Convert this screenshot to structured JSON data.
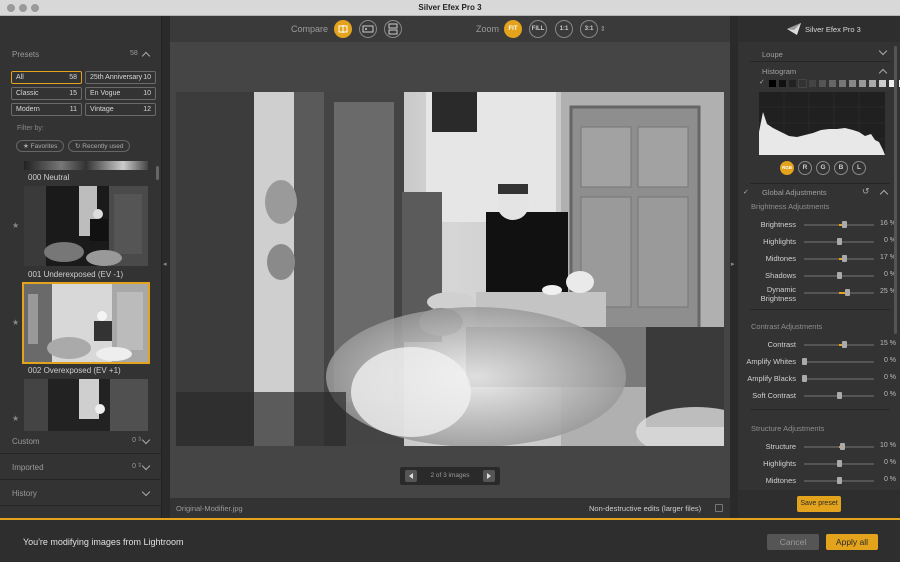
{
  "window": {
    "title": "Silver Efex Pro 3"
  },
  "left_panel": {
    "presets_label": "Presets",
    "presets_count": "58",
    "preset_categories": [
      {
        "name": "All",
        "count": "58"
      },
      {
        "name": "25th Anniversary",
        "count": "10"
      },
      {
        "name": "Classic",
        "count": "15"
      },
      {
        "name": "En Vogue",
        "count": "10"
      },
      {
        "name": "Modern",
        "count": "11"
      },
      {
        "name": "Vintage",
        "count": "12"
      }
    ],
    "filter_label": "Filter by:",
    "filters": [
      "Favorites",
      "Recently used"
    ],
    "thumbnails": [
      "000 Neutral",
      "001 Underexposed (EV -1)",
      "002 Overexposed (EV +1)"
    ],
    "sections": [
      {
        "name": "Custom",
        "count": "0"
      },
      {
        "name": "Imported",
        "count": "0"
      },
      {
        "name": "History",
        "count": ""
      }
    ]
  },
  "toolbar": {
    "compare_label": "Compare",
    "zoom_label": "Zoom",
    "zoom_options": [
      "FIT",
      "FILL",
      "1:1",
      "3:1"
    ]
  },
  "preview": {
    "pager_text": "2 of 3 images",
    "filename": "Original-Modifier.jpg",
    "nondestructive_label": "Non-destructive edits (larger files)"
  },
  "right_panel": {
    "logo_text": "Silver Efex Pro 3",
    "loupe_label": "Loupe",
    "histogram_label": "Histogram",
    "histogram_channels": [
      "RGB",
      "R",
      "G",
      "B",
      "L"
    ],
    "global_label": "Global Adjustments",
    "groups": [
      {
        "title": "Brightness Adjustments",
        "sliders": [
          {
            "name": "Brightness",
            "value": "16 %",
            "pct": 16
          },
          {
            "name": "Highlights",
            "value": "0 %",
            "pct": 0
          },
          {
            "name": "Midtones",
            "value": "17 %",
            "pct": 17
          },
          {
            "name": "Shadows",
            "value": "0 %",
            "pct": 0
          },
          {
            "name": "Dynamic Brightness",
            "value": "25 %",
            "pct": 25
          }
        ]
      },
      {
        "title": "Contrast Adjustments",
        "sliders": [
          {
            "name": "Contrast",
            "value": "15 %",
            "pct": 15
          },
          {
            "name": "Amplify Whites",
            "value": "0 %",
            "pct": 0,
            "origin": "left"
          },
          {
            "name": "Amplify Blacks",
            "value": "0 %",
            "pct": 0,
            "origin": "left"
          },
          {
            "name": "Soft Contrast",
            "value": "0 %",
            "pct": 0
          }
        ]
      },
      {
        "title": "Structure Adjustments",
        "sliders": [
          {
            "name": "Structure",
            "value": "10 %",
            "pct": 10
          },
          {
            "name": "Highlights",
            "value": "0 %",
            "pct": 0
          },
          {
            "name": "Midtones",
            "value": "0 %",
            "pct": 0
          }
        ]
      }
    ],
    "save_preset_label": "Save preset"
  },
  "bottom_bar": {
    "message": "You're modifying images from Lightroom",
    "cancel_label": "Cancel",
    "apply_label": "Apply all"
  },
  "colors": {
    "accent": "#e3a31c",
    "panel": "#333333",
    "canvas": "#454545"
  }
}
